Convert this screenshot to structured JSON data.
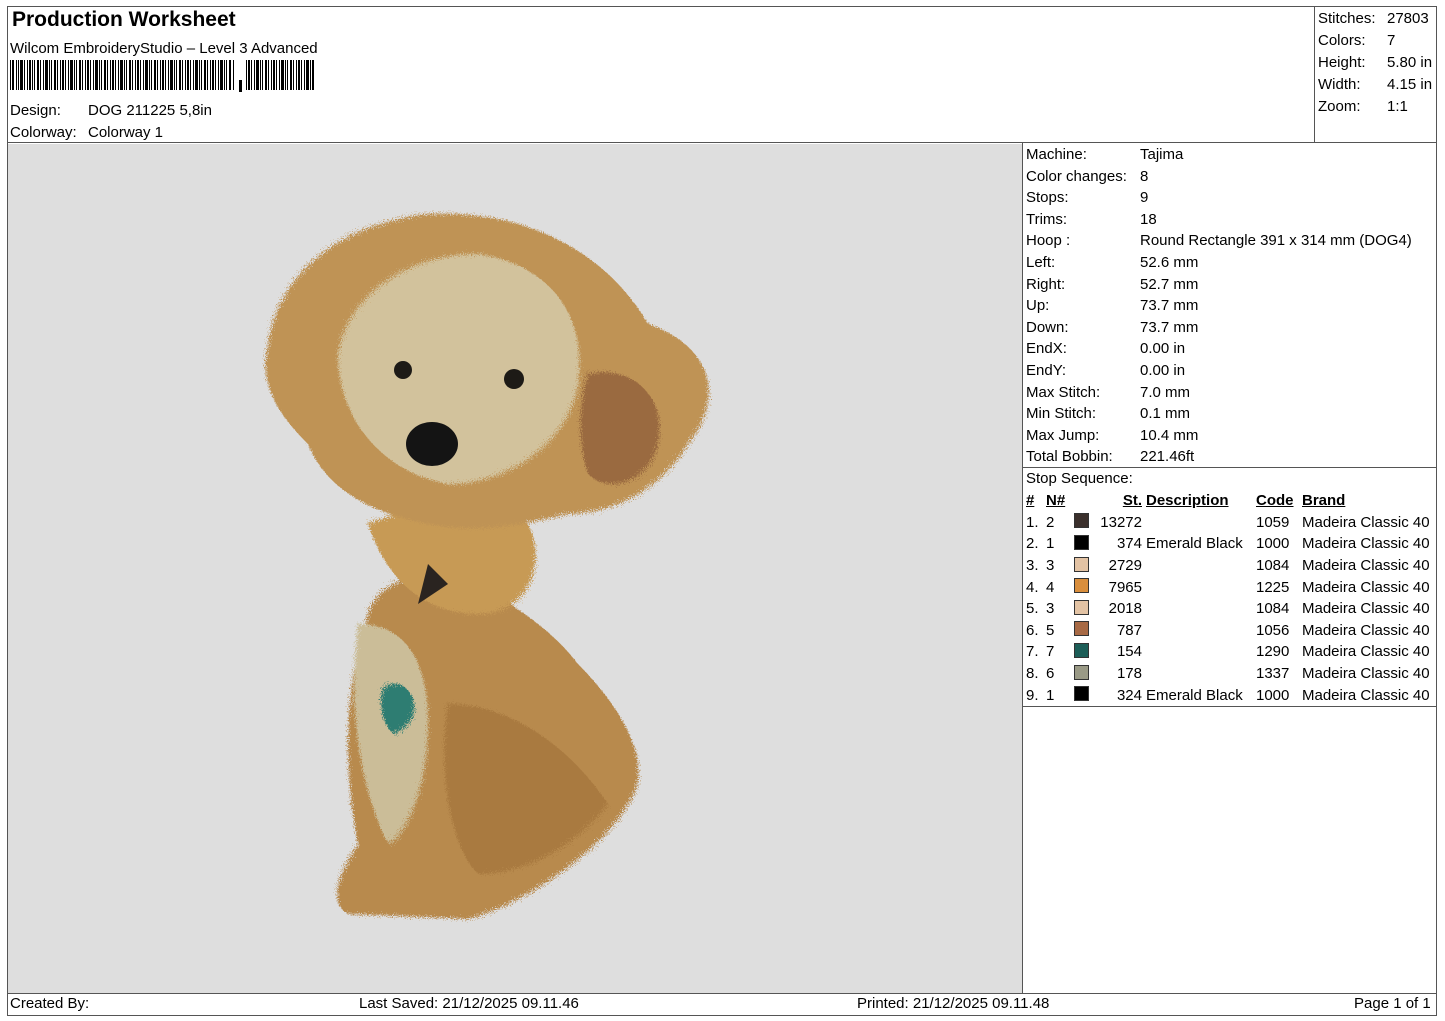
{
  "header": {
    "title": "Production Worksheet",
    "software": "Wilcom EmbroideryStudio – Level 3 Advanced",
    "design_label": "Design:",
    "design_value": "DOG 211225 5,8in",
    "colorway_label": "Colorway:",
    "colorway_value": "Colorway 1"
  },
  "stats": [
    {
      "label": "Stitches:",
      "value": "27803"
    },
    {
      "label": "Colors:",
      "value": "7"
    },
    {
      "label": "Height:",
      "value": "5.80 in"
    },
    {
      "label": "Width:",
      "value": "4.15 in"
    },
    {
      "label": "Zoom:",
      "value": "1:1"
    }
  ],
  "specs": [
    {
      "label": "Machine:",
      "value": "Tajima"
    },
    {
      "label": "Color changes:",
      "value": "8"
    },
    {
      "label": "Stops:",
      "value": "9"
    },
    {
      "label": "Trims:",
      "value": "18"
    },
    {
      "label": "Hoop :",
      "value": "Round Rectangle 391 x 314 mm (DOG4)"
    },
    {
      "label": "Left:",
      "value": "52.6 mm"
    },
    {
      "label": "Right:",
      "value": "52.7 mm"
    },
    {
      "label": "Up:",
      "value": "73.7 mm"
    },
    {
      "label": "Down:",
      "value": "73.7 mm"
    },
    {
      "label": "EndX:",
      "value": "0.00 in"
    },
    {
      "label": "EndY:",
      "value": "0.00 in"
    },
    {
      "label": "Max Stitch:",
      "value": "7.0 mm"
    },
    {
      "label": "Min Stitch:",
      "value": "0.1 mm"
    },
    {
      "label": "Max Jump:",
      "value": "10.4 mm"
    },
    {
      "label": "Total Bobbin:",
      "value": "221.46ft"
    }
  ],
  "stop_sequence": {
    "title": "Stop Sequence:",
    "headers": {
      "num": "#",
      "n": "N#",
      "st": "St.",
      "desc": "Description",
      "code": "Code",
      "brand": "Brand"
    },
    "rows": [
      {
        "num": "1.",
        "n": "2",
        "color": "#3b302c",
        "st": "13272",
        "desc": "",
        "code": "1059",
        "brand": "Madeira Classic 40"
      },
      {
        "num": "2.",
        "n": "1",
        "color": "#000000",
        "st": "374",
        "desc": "Emerald Black",
        "code": "1000",
        "brand": "Madeira Classic 40"
      },
      {
        "num": "3.",
        "n": "3",
        "color": "#e3c3a4",
        "st": "2729",
        "desc": "",
        "code": "1084",
        "brand": "Madeira Classic 40"
      },
      {
        "num": "4.",
        "n": "4",
        "color": "#d98e3c",
        "st": "7965",
        "desc": "",
        "code": "1225",
        "brand": "Madeira Classic 40"
      },
      {
        "num": "5.",
        "n": "3",
        "color": "#e3c3a4",
        "st": "2018",
        "desc": "",
        "code": "1084",
        "brand": "Madeira Classic 40"
      },
      {
        "num": "6.",
        "n": "5",
        "color": "#a86a45",
        "st": "787",
        "desc": "",
        "code": "1056",
        "brand": "Madeira Classic 40"
      },
      {
        "num": "7.",
        "n": "7",
        "color": "#1d5e58",
        "st": "154",
        "desc": "",
        "code": "1290",
        "brand": "Madeira Classic 40"
      },
      {
        "num": "8.",
        "n": "6",
        "color": "#9a9a86",
        "st": "178",
        "desc": "",
        "code": "1337",
        "brand": "Madeira Classic 40"
      },
      {
        "num": "9.",
        "n": "1",
        "color": "#000000",
        "st": "324",
        "desc": "Emerald Black",
        "code": "1000",
        "brand": "Madeira Classic 40"
      }
    ]
  },
  "footer": {
    "created_by": "Created By:",
    "last_saved": "Last Saved: 21/12/2025 09.11.46",
    "printed": "Printed: 21/12/2025 09.11.48",
    "page": "Page 1 of 1"
  }
}
